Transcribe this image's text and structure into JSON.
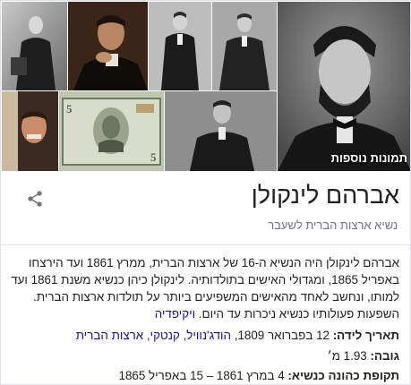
{
  "knowledge_panel": {
    "more_images_label": "תמונות נוספות",
    "title": "אברהם לינקולן",
    "subtitle": "נשיא ארצות הברית לשעבר",
    "description": "אברהם לינקולן היה הנשיא ה-16 של ארצות הברית, ממרץ 1861 ועד הירצחו באפריל 1865, ומגדולי האישים בתולדותיה. לינקולן כיהן כנשיא משנת 1861 ועד למותו, ונחשב לאחד מהאישים המשפיעים ביותר על תולדות ארצות הברית. השפעות פעולותיו כנשיא ניכרות עד היום.",
    "source_link": "ויקיפדיה",
    "facts": {
      "born_label": "תאריך לידה:",
      "born_value": "12 בפברואר 1809,",
      "born_place": "הודג'נוויל, קנטקי, ארצות הברית",
      "height_label": "גובה:",
      "height_value": "1.93 מ׳",
      "term_label": "תקופת כהונה כנשיא:",
      "term_value": "4 במרץ 1861 – 15 באפריל 1865"
    },
    "icons": {
      "share": "share-icon"
    },
    "colors": {
      "link": "#1a0dab",
      "subtitle": "#70757a",
      "divider": "#dfe1e5"
    }
  }
}
